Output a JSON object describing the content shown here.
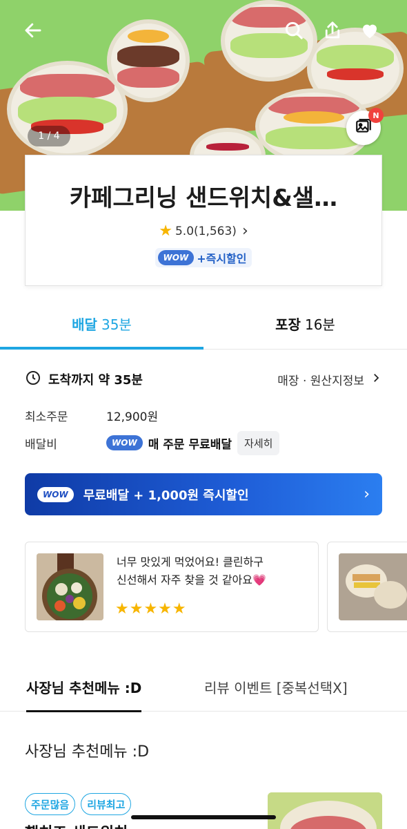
{
  "hero": {
    "photo_counter": "1 / 4",
    "gallery_badge": "N",
    "icons": [
      "back-arrow-icon",
      "search-icon",
      "share-icon",
      "heart-icon",
      "gallery-icon"
    ]
  },
  "store": {
    "name": "카페그리닝 샌드위치&샐…",
    "rating": "5.0(1,563)",
    "rating_chevron": "›",
    "promo_badge": "WOW",
    "promo_text": "+즉시할인"
  },
  "order_tabs": [
    {
      "label": "배달",
      "value": "35분"
    },
    {
      "label": "포장",
      "value": "16분"
    }
  ],
  "info": {
    "eta": "도착까지 약 35분",
    "store_info_link": "매장 · 원산지정보",
    "min_order_label": "최소주문",
    "min_order_value": "12,900원",
    "delivery_fee_label": "배달비",
    "delivery_fee_badge": "WOW",
    "delivery_fee_text": "매 주문 무료배달",
    "detail_button": "자세히"
  },
  "wow_banner": {
    "badge": "WOW",
    "text": "무료배달 + 1,000원 즉시할인",
    "chevron": "›"
  },
  "review": {
    "line1": "너무 맛있게 먹었어요! 클린하구",
    "line2": "신선해서 자주 찾을 것 같아요💗",
    "stars": "★★★★★",
    "rating_value": 5
  },
  "menu_tabs": [
    {
      "label": "사장님 추천메뉴 :D"
    },
    {
      "label": "리뷰 이벤트 [중복선택X]"
    }
  ],
  "section": {
    "title": "사장님 추천메뉴 :D"
  },
  "menu_item": {
    "badges": [
      "주문많음",
      "리뷰최고"
    ],
    "name": "햄치즈 샌드위치"
  },
  "colors": {
    "accent": "#1ea6e2",
    "wow_blue": "#1f4fc2",
    "star": "#f7b500",
    "notice_red": "#f0413d"
  }
}
